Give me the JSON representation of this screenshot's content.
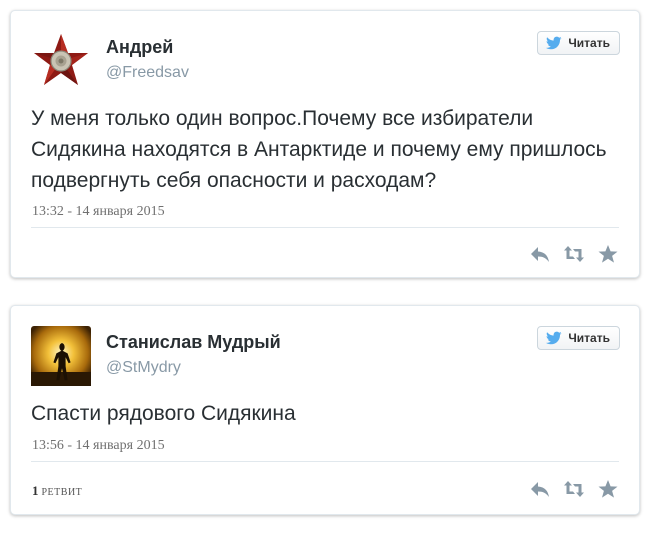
{
  "tweets": [
    {
      "author_name": "Андрей",
      "author_handle": "@Freedsav",
      "follow_label": "Читать",
      "text": "У меня только один вопрос.Почему все избиратели Сидякина находятся в Антарктиде и почему ему пришлось подвергнуть себя опасности и расходам?",
      "timestamp": "13:32 - 14 января 2015",
      "avatar_icon": "red-star-icon"
    },
    {
      "author_name": "Станислав Мудрый",
      "author_handle": "@StMydry",
      "follow_label": "Читать",
      "text": "Спасти рядового Сидякина",
      "timestamp": "13:56 - 14 января 2015",
      "retweet_count": "1",
      "retweet_label": "РЕТВИТ",
      "avatar_icon": "silhouette-photo-icon"
    }
  ],
  "colors": {
    "twitter_blue": "#55acee",
    "action_icon": "#8899a6",
    "star_red": "#8e1a14"
  }
}
